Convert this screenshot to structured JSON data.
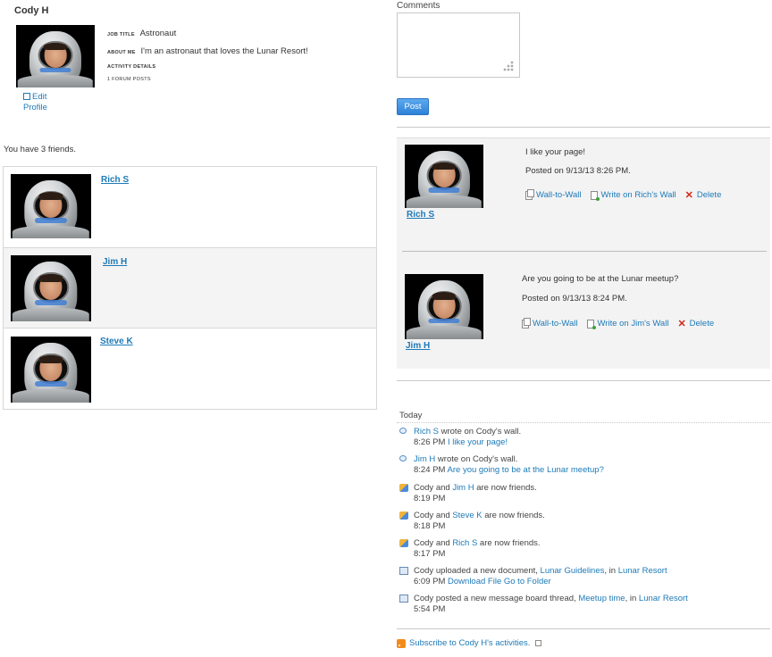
{
  "profile": {
    "name": "Cody H",
    "job_title_label": "Job Title",
    "job_title": "Astronaut",
    "about_label": "About Me",
    "about": "I'm an astronaut that loves the Lunar Resort!",
    "activity_label": "Activity Details",
    "forum_posts": "1 Forum Posts",
    "edit_label": "Edit",
    "profile_label": "Profile",
    "edit_icon": "edit-icon"
  },
  "friends": {
    "summary": "You have 3 friends.",
    "items": [
      {
        "name": "Rich S"
      },
      {
        "name": "Jim H"
      },
      {
        "name": "Steve K"
      }
    ]
  },
  "comment_form": {
    "label": "Comments",
    "value": "",
    "post_label": "Post"
  },
  "wall": {
    "entries": [
      {
        "poster": "Rich S",
        "message": "I like your page!",
        "posted": "Posted on 9/13/13 8:26 PM.",
        "wall_to_wall": "Wall-to-Wall",
        "write_on": "Write on Rich's Wall",
        "delete": "Delete"
      },
      {
        "poster": "Jim H",
        "message": "Are you going to be at the Lunar meetup?",
        "posted": "Posted on 9/13/13 8:24 PM.",
        "wall_to_wall": "Wall-to-Wall",
        "write_on": "Write on Jim's Wall",
        "delete": "Delete"
      }
    ]
  },
  "activities": {
    "day_label": "Today",
    "items": [
      {
        "icon": "comment-bubble-icon",
        "actor": "Rich S",
        "text": " wrote on Cody's wall.",
        "time": "8:26 PM",
        "detail": "I like your page!"
      },
      {
        "icon": "comment-bubble-icon",
        "actor": "Jim H",
        "text": " wrote on Cody's wall.",
        "time": "8:24 PM",
        "detail": "Are you going to be at the Lunar meetup?"
      },
      {
        "icon": "friends-icon",
        "pre": "Cody and ",
        "actor": "Jim H",
        "text": " are now friends.",
        "time": "8:19 PM"
      },
      {
        "icon": "friends-icon",
        "pre": "Cody and ",
        "actor": "Steve K",
        "text": " are now friends.",
        "time": "8:18 PM"
      },
      {
        "icon": "friends-icon",
        "pre": "Cody and ",
        "actor": "Rich S",
        "text": " are now friends.",
        "time": "8:17 PM"
      },
      {
        "icon": "document-icon",
        "pre": "Cody uploaded a new document, ",
        "link1": "Lunar Guidelines",
        "mid": ", in ",
        "link2": "Lunar Resort",
        "time": "6:09 PM",
        "detail": "Download File",
        "detail2": "Go to Folder"
      },
      {
        "icon": "message-board-icon",
        "pre": "Cody posted a new message board thread, ",
        "link1": "Meetup time",
        "mid": ", in ",
        "link2": "Lunar Resort",
        "time": "5:54 PM"
      }
    ],
    "subscribe": "Subscribe to Cody H's activities."
  }
}
